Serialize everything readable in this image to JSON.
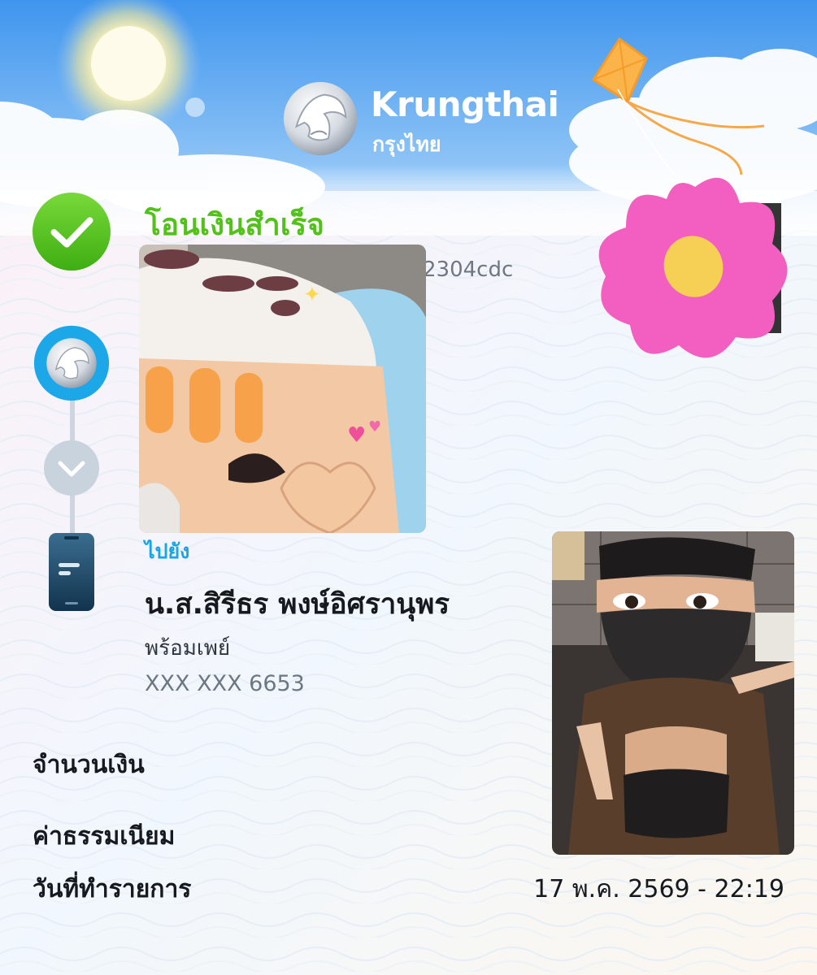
{
  "header": {
    "brand_name": "Krungthai",
    "brand_name_thai": "กรุงไทย"
  },
  "status": {
    "title": "โอนเงินสำเร็จ",
    "reference_partial": "2304cdc"
  },
  "recipient": {
    "to_label": "ไปยัง",
    "name": "น.ส.สิรีธร พงษ์อิศรานุพร",
    "service": "พร้อมเพย์",
    "account": "XXX XXX 6653"
  },
  "details": {
    "amount_label": "จำนวนเงิน",
    "fee_label": "ค่าธรรมเนียม",
    "date_label": "วันที่ทำรายการ",
    "date_value": "17 พ.ค. 2569 - 22:19"
  },
  "colors": {
    "sky_top": "#4a9ff0",
    "success_green": "#52c11a",
    "link_blue": "#19a5e5",
    "flower_pink": "#f35fc0",
    "flower_center": "#f6cf55"
  },
  "icons": {
    "check": "check-icon",
    "bank_logo": "krungthai-logo-icon",
    "chevron": "chevron-down-icon",
    "phone": "phone-icon"
  }
}
